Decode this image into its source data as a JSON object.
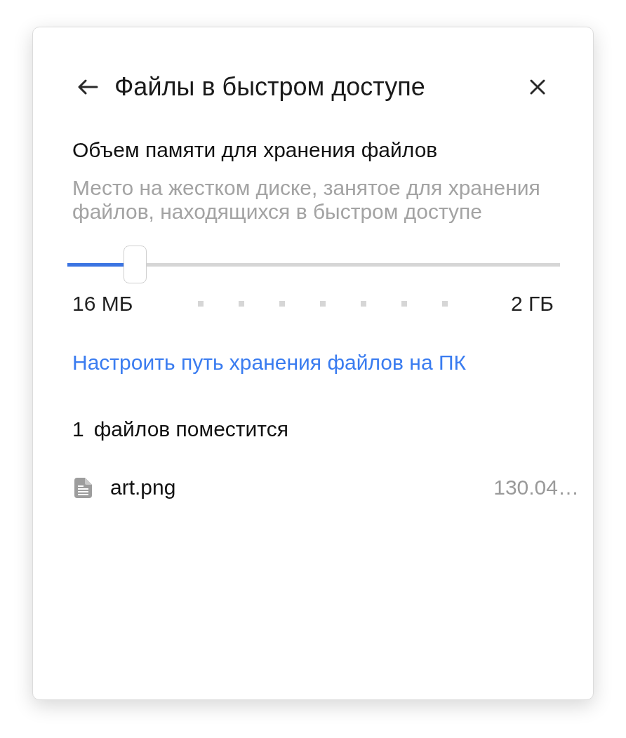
{
  "header": {
    "title": "Файлы в быстром доступе"
  },
  "storage": {
    "title": "Объем памяти для хранения файлов",
    "description": "Место на жестком диске, занятое для хранения файлов, находящихся в быстром доступе",
    "slider": {
      "level": 0.137,
      "min_label": "16 МБ",
      "max_label": "2 ГБ"
    }
  },
  "path_link": "Настроить путь хранения файлов на ПК",
  "fit_summary": {
    "count": "1",
    "label": "файлов поместится"
  },
  "files": [
    {
      "name": "art.png",
      "size": "130.04…"
    }
  ]
}
